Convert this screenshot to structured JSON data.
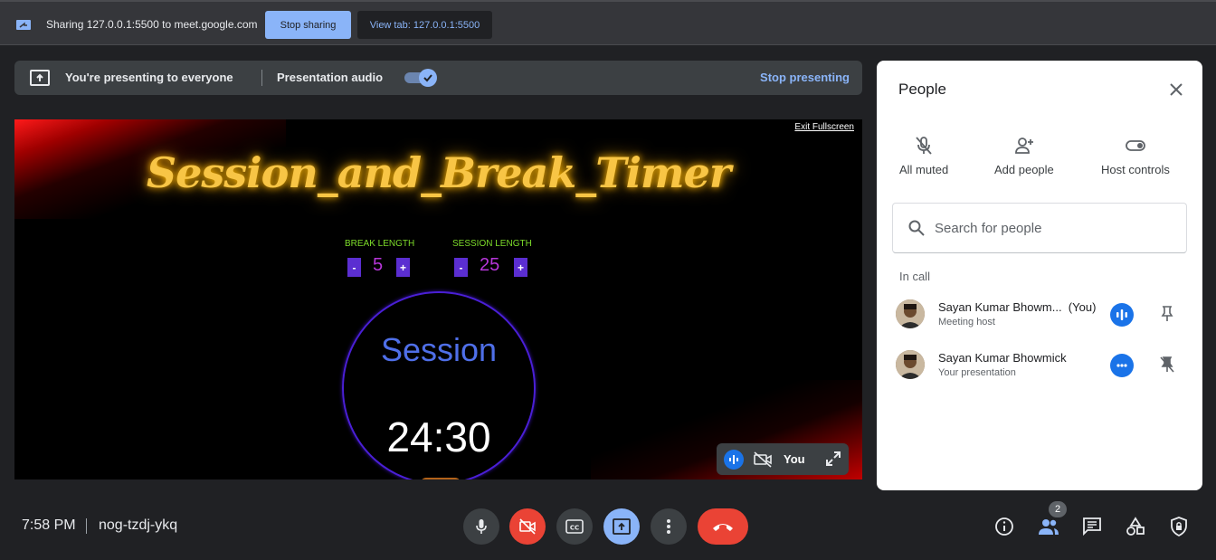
{
  "share_bar": {
    "text": "Sharing 127.0.0.1:5500 to meet.google.com",
    "stop_sharing": "Stop sharing",
    "view_tab": "View tab: 127.0.0.1:5500"
  },
  "presenting_bar": {
    "status": "You're presenting to everyone",
    "audio_label": "Presentation audio",
    "audio_on": true,
    "stop_presenting": "Stop presenting"
  },
  "presentation": {
    "exit_fullscreen": "Exit Fullscreen",
    "title": "Session_and_Break_Timer",
    "break_length_label": "BREAK LENGTH",
    "break_length_value": "5",
    "session_length_label": "SESSION LENGTH",
    "session_length_value": "25",
    "decrement": "-",
    "increment": "+",
    "timer_label": "Session",
    "time_left": "24:30"
  },
  "self_view": {
    "label": "You"
  },
  "people_panel": {
    "title": "People",
    "actions": [
      {
        "label": "All muted",
        "icon": "mic-off-icon"
      },
      {
        "label": "Add people",
        "icon": "person-add-icon"
      },
      {
        "label": "Host controls",
        "icon": "toggle-icon"
      }
    ],
    "search_placeholder": "Search for people",
    "section_label": "In call",
    "participants": [
      {
        "name": "Sayan Kumar Bhowm...",
        "suffix": "(You)",
        "role": "Meeting host",
        "status": "speaking"
      },
      {
        "name": "Sayan Kumar Bhowmick",
        "suffix": "",
        "role": "Your presentation",
        "status": "more"
      }
    ]
  },
  "bottom_bar": {
    "time": "7:58 PM",
    "meeting_code": "nog-tzdj-ykq",
    "people_count": "2"
  },
  "colors": {
    "accent": "#8ab4f8",
    "danger": "#ea4335",
    "title_glow": "#f8c545",
    "brand_blue": "#1a73e8"
  }
}
